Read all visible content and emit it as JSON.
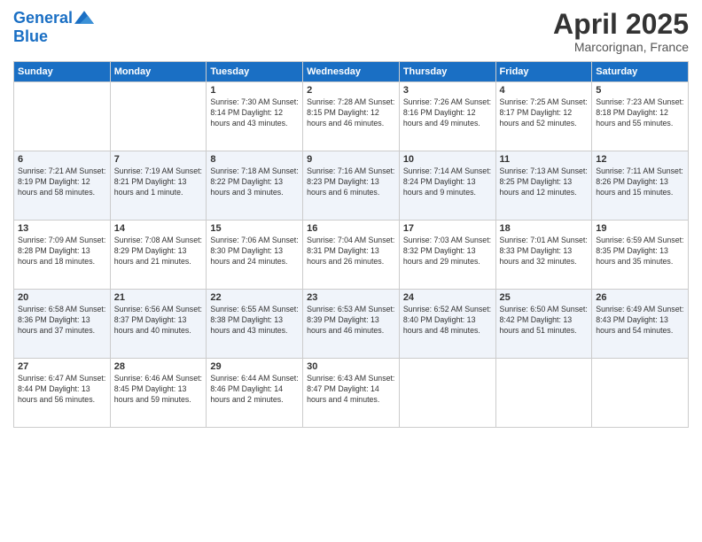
{
  "header": {
    "logo_line1": "General",
    "logo_line2": "Blue",
    "title": "April 2025",
    "location": "Marcorignan, France"
  },
  "days_of_week": [
    "Sunday",
    "Monday",
    "Tuesday",
    "Wednesday",
    "Thursday",
    "Friday",
    "Saturday"
  ],
  "weeks": [
    [
      {
        "day": "",
        "info": ""
      },
      {
        "day": "",
        "info": ""
      },
      {
        "day": "1",
        "info": "Sunrise: 7:30 AM\nSunset: 8:14 PM\nDaylight: 12 hours and 43 minutes."
      },
      {
        "day": "2",
        "info": "Sunrise: 7:28 AM\nSunset: 8:15 PM\nDaylight: 12 hours and 46 minutes."
      },
      {
        "day": "3",
        "info": "Sunrise: 7:26 AM\nSunset: 8:16 PM\nDaylight: 12 hours and 49 minutes."
      },
      {
        "day": "4",
        "info": "Sunrise: 7:25 AM\nSunset: 8:17 PM\nDaylight: 12 hours and 52 minutes."
      },
      {
        "day": "5",
        "info": "Sunrise: 7:23 AM\nSunset: 8:18 PM\nDaylight: 12 hours and 55 minutes."
      }
    ],
    [
      {
        "day": "6",
        "info": "Sunrise: 7:21 AM\nSunset: 8:19 PM\nDaylight: 12 hours and 58 minutes."
      },
      {
        "day": "7",
        "info": "Sunrise: 7:19 AM\nSunset: 8:21 PM\nDaylight: 13 hours and 1 minute."
      },
      {
        "day": "8",
        "info": "Sunrise: 7:18 AM\nSunset: 8:22 PM\nDaylight: 13 hours and 3 minutes."
      },
      {
        "day": "9",
        "info": "Sunrise: 7:16 AM\nSunset: 8:23 PM\nDaylight: 13 hours and 6 minutes."
      },
      {
        "day": "10",
        "info": "Sunrise: 7:14 AM\nSunset: 8:24 PM\nDaylight: 13 hours and 9 minutes."
      },
      {
        "day": "11",
        "info": "Sunrise: 7:13 AM\nSunset: 8:25 PM\nDaylight: 13 hours and 12 minutes."
      },
      {
        "day": "12",
        "info": "Sunrise: 7:11 AM\nSunset: 8:26 PM\nDaylight: 13 hours and 15 minutes."
      }
    ],
    [
      {
        "day": "13",
        "info": "Sunrise: 7:09 AM\nSunset: 8:28 PM\nDaylight: 13 hours and 18 minutes."
      },
      {
        "day": "14",
        "info": "Sunrise: 7:08 AM\nSunset: 8:29 PM\nDaylight: 13 hours and 21 minutes."
      },
      {
        "day": "15",
        "info": "Sunrise: 7:06 AM\nSunset: 8:30 PM\nDaylight: 13 hours and 24 minutes."
      },
      {
        "day": "16",
        "info": "Sunrise: 7:04 AM\nSunset: 8:31 PM\nDaylight: 13 hours and 26 minutes."
      },
      {
        "day": "17",
        "info": "Sunrise: 7:03 AM\nSunset: 8:32 PM\nDaylight: 13 hours and 29 minutes."
      },
      {
        "day": "18",
        "info": "Sunrise: 7:01 AM\nSunset: 8:33 PM\nDaylight: 13 hours and 32 minutes."
      },
      {
        "day": "19",
        "info": "Sunrise: 6:59 AM\nSunset: 8:35 PM\nDaylight: 13 hours and 35 minutes."
      }
    ],
    [
      {
        "day": "20",
        "info": "Sunrise: 6:58 AM\nSunset: 8:36 PM\nDaylight: 13 hours and 37 minutes."
      },
      {
        "day": "21",
        "info": "Sunrise: 6:56 AM\nSunset: 8:37 PM\nDaylight: 13 hours and 40 minutes."
      },
      {
        "day": "22",
        "info": "Sunrise: 6:55 AM\nSunset: 8:38 PM\nDaylight: 13 hours and 43 minutes."
      },
      {
        "day": "23",
        "info": "Sunrise: 6:53 AM\nSunset: 8:39 PM\nDaylight: 13 hours and 46 minutes."
      },
      {
        "day": "24",
        "info": "Sunrise: 6:52 AM\nSunset: 8:40 PM\nDaylight: 13 hours and 48 minutes."
      },
      {
        "day": "25",
        "info": "Sunrise: 6:50 AM\nSunset: 8:42 PM\nDaylight: 13 hours and 51 minutes."
      },
      {
        "day": "26",
        "info": "Sunrise: 6:49 AM\nSunset: 8:43 PM\nDaylight: 13 hours and 54 minutes."
      }
    ],
    [
      {
        "day": "27",
        "info": "Sunrise: 6:47 AM\nSunset: 8:44 PM\nDaylight: 13 hours and 56 minutes."
      },
      {
        "day": "28",
        "info": "Sunrise: 6:46 AM\nSunset: 8:45 PM\nDaylight: 13 hours and 59 minutes."
      },
      {
        "day": "29",
        "info": "Sunrise: 6:44 AM\nSunset: 8:46 PM\nDaylight: 14 hours and 2 minutes."
      },
      {
        "day": "30",
        "info": "Sunrise: 6:43 AM\nSunset: 8:47 PM\nDaylight: 14 hours and 4 minutes."
      },
      {
        "day": "",
        "info": ""
      },
      {
        "day": "",
        "info": ""
      },
      {
        "day": "",
        "info": ""
      }
    ]
  ]
}
